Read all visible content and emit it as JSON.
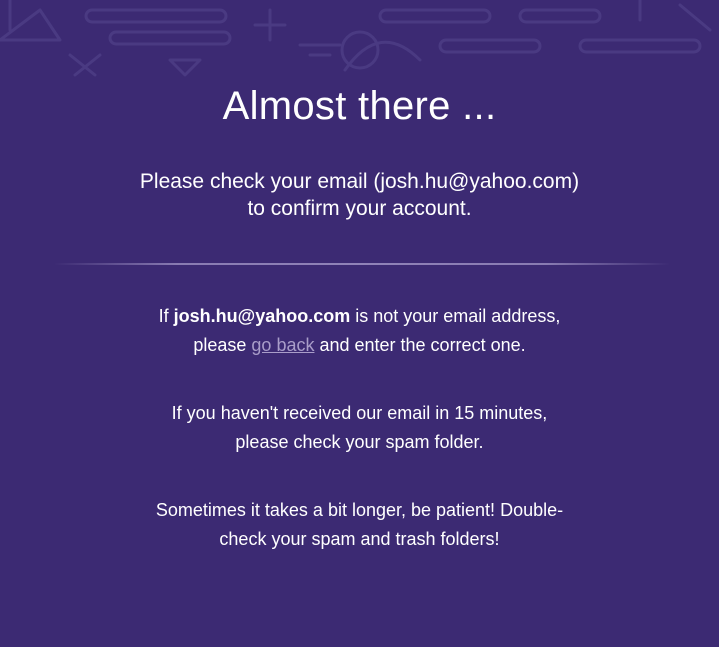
{
  "headline": "Almost there ...",
  "subtitle": {
    "line1": "Please check your email (josh.hu@yahoo.com)",
    "line2": "to confirm your account."
  },
  "wrong_email": {
    "prefix": "If ",
    "email": "josh.hu@yahoo.com",
    "suffix": " is not your email address,",
    "line2_prefix": "please ",
    "link_text": "go back",
    "line2_suffix": " and enter the correct one."
  },
  "spam_notice": {
    "line1": "If you haven't received our email in 15 minutes,",
    "line2": "please check your spam folder."
  },
  "patience_notice": {
    "line1": "Sometimes it takes a bit longer, be patient! Double-",
    "line2": "check your spam and trash folders!"
  },
  "colors": {
    "background": "#3c2a73",
    "text": "#ffffff",
    "link": "#a99dc9"
  }
}
